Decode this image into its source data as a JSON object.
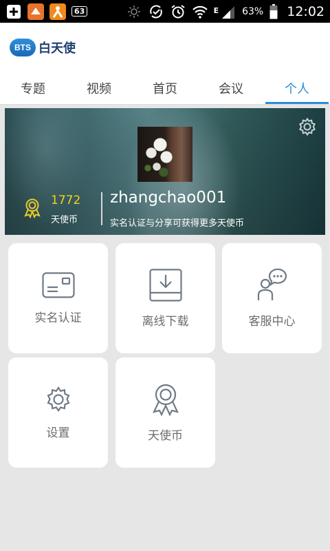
{
  "status_bar": {
    "left_icons": [
      "add-icon",
      "app-notification-icon",
      "app-notification-icon-2"
    ],
    "badge": "63",
    "right_icons": [
      "brightness-icon",
      "sync-icon",
      "alarm-icon",
      "wifi-icon",
      "signal-icon"
    ],
    "network": "E",
    "battery_percent": "63%",
    "time": "12:02"
  },
  "app": {
    "logo_mark": "BTS",
    "logo_text": "白天使"
  },
  "tabs": [
    {
      "label": "专题",
      "active": false
    },
    {
      "label": "视频",
      "active": false
    },
    {
      "label": "首页",
      "active": false
    },
    {
      "label": "会议",
      "active": false
    },
    {
      "label": "个人",
      "active": true
    }
  ],
  "profile": {
    "coins": "1772",
    "coins_label": "天使币",
    "username": "zhangchao001",
    "hint": "实名认证与分享可获得更多天使币"
  },
  "menu": [
    {
      "label": "实名认证",
      "icon": "id-card-icon"
    },
    {
      "label": "离线下载",
      "icon": "download-icon"
    },
    {
      "label": "客服中心",
      "icon": "customer-service-icon"
    },
    {
      "label": "设置",
      "icon": "gear-icon"
    },
    {
      "label": "天使币",
      "icon": "medal-icon"
    }
  ],
  "colors": {
    "accent": "#2b8ed6",
    "coin": "#f5d21a",
    "icon_gray": "#6f7a86"
  }
}
